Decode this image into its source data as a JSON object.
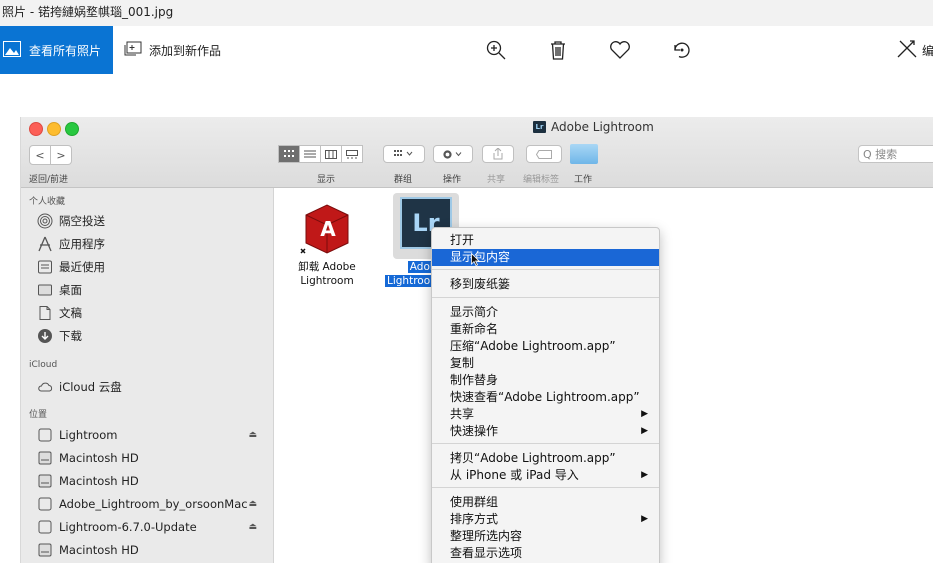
{
  "window": {
    "title": "照片 - 锘挎縺娲堥帺瑙_001.jpg"
  },
  "toolbar": {
    "view_all_label": "查看所有照片",
    "add_to_creation_label": "添加到新作品",
    "edit_label": "编",
    "icons": [
      "zoom-in-icon",
      "delete-icon",
      "heart-icon",
      "rotate-icon",
      "edit-icon"
    ]
  },
  "finder": {
    "title": "Adobe Lightroom",
    "title_icon_text": "Lr",
    "nav_label": "返回/前进",
    "nav_back": "<",
    "nav_forward": ">",
    "toolbar_labels": {
      "display": "显示",
      "group": "群组",
      "action": "操作",
      "share": "共享",
      "tags": "编辑标签",
      "work": "工作"
    },
    "search_placeholder": "Q 搜索",
    "sidebar": {
      "favorites_header": "个人收藏",
      "favorites": [
        "隔空投送",
        "应用程序",
        "最近使用",
        "桌面",
        "文稿",
        "下载"
      ],
      "icloud_header": "iCloud",
      "icloud": [
        "iCloud 云盘"
      ],
      "locations_header": "位置",
      "locations": [
        {
          "label": "Lightroom",
          "eject": "⏏"
        },
        {
          "label": "Macintosh HD",
          "eject": ""
        },
        {
          "label": "Macintosh HD",
          "eject": ""
        },
        {
          "label": "Adobe_Lightroom_by_orsoonMac",
          "eject": "⏏"
        },
        {
          "label": "Lightroom-6.7.0-Update",
          "eject": "⏏"
        },
        {
          "label": "Macintosh HD",
          "eject": ""
        }
      ]
    },
    "files": {
      "uninstall_label_line1": "卸载 Adobe",
      "uninstall_label_line2": "Lightroom",
      "uninstall_icon_text": "A",
      "app_label_line1": "Adobe",
      "app_label_line2": "Lightroo",
      "app_icon_text": "Lr"
    },
    "context_menu": {
      "items": [
        {
          "label": "打开"
        },
        {
          "label": "显示包内容",
          "highlighted": true
        },
        {
          "label": "移到废纸篓"
        },
        {
          "label": "显示简介"
        },
        {
          "label": "重新命名"
        },
        {
          "label": "压缩“Adobe Lightroom.app”"
        },
        {
          "label": "复制"
        },
        {
          "label": "制作替身"
        },
        {
          "label": "快速查看“Adobe Lightroom.app”"
        },
        {
          "label": "共享",
          "submenu": true
        },
        {
          "label": "快速操作",
          "submenu": true
        },
        {
          "label": "拷贝“Adobe Lightroom.app”"
        },
        {
          "label": "从 iPhone 或 iPad 导入",
          "submenu": true
        },
        {
          "label": "使用群组"
        },
        {
          "label": "排序方式",
          "submenu": true
        },
        {
          "label": "整理所选内容"
        },
        {
          "label": "查看显示选项"
        }
      ],
      "submenu_arrow": "▶"
    }
  },
  "colors": {
    "accent": "#0a74d3",
    "menu_highlight": "#1a67d6",
    "lr_dark": "#1f3446"
  }
}
